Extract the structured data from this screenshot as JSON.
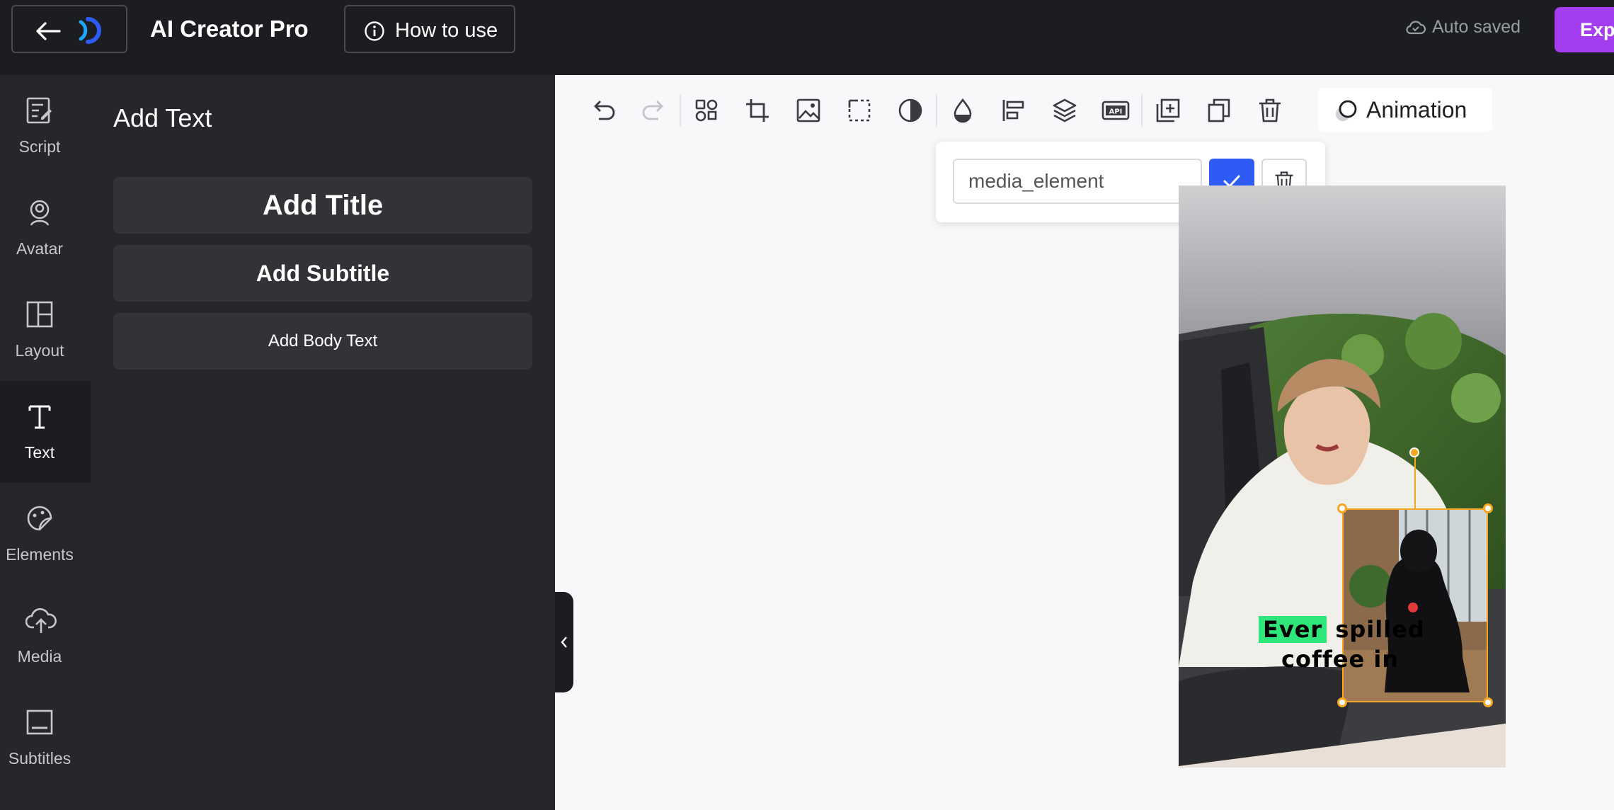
{
  "header": {
    "app_title": "AI Creator Pro",
    "how_to_use": "How to use",
    "auto_saved": "Auto saved",
    "explore": "Explo"
  },
  "nav": {
    "items": [
      {
        "label": "Script",
        "icon": "script-icon"
      },
      {
        "label": "Avatar",
        "icon": "avatar-icon"
      },
      {
        "label": "Layout",
        "icon": "layout-icon"
      },
      {
        "label": "Text",
        "icon": "text-icon",
        "active": true
      },
      {
        "label": "Elements",
        "icon": "elements-icon"
      },
      {
        "label": "Media",
        "icon": "media-upload-icon"
      },
      {
        "label": "Subtitles",
        "icon": "subtitles-icon"
      }
    ]
  },
  "panel": {
    "title": "Add Text",
    "add_title": "Add Title",
    "add_subtitle": "Add Subtitle",
    "add_body": "Add Body Text"
  },
  "toolbar": {
    "icons": [
      "undo-icon",
      "redo-icon",
      "smart-select-icon",
      "crop-icon",
      "replace-image-icon",
      "mask-icon",
      "contrast-icon",
      "color-drop-icon",
      "align-icon",
      "layers-icon",
      "api-icon",
      "duplicate-add-icon",
      "copy-icon",
      "delete-icon"
    ],
    "animation_label": "Animation"
  },
  "element_name": {
    "value": "media_element"
  },
  "video": {
    "caption_word_highlight": "Ever",
    "caption_line1_rest": "spilled",
    "caption_line2": "coffee in"
  },
  "colors": {
    "topbar_bg": "#1c1d20",
    "panel_bg": "#26272b",
    "accent_purple": "#a43df0",
    "confirm_blue": "#2f5bf5",
    "selection_orange": "#f5a623",
    "caption_highlight": "#2ee67a"
  }
}
